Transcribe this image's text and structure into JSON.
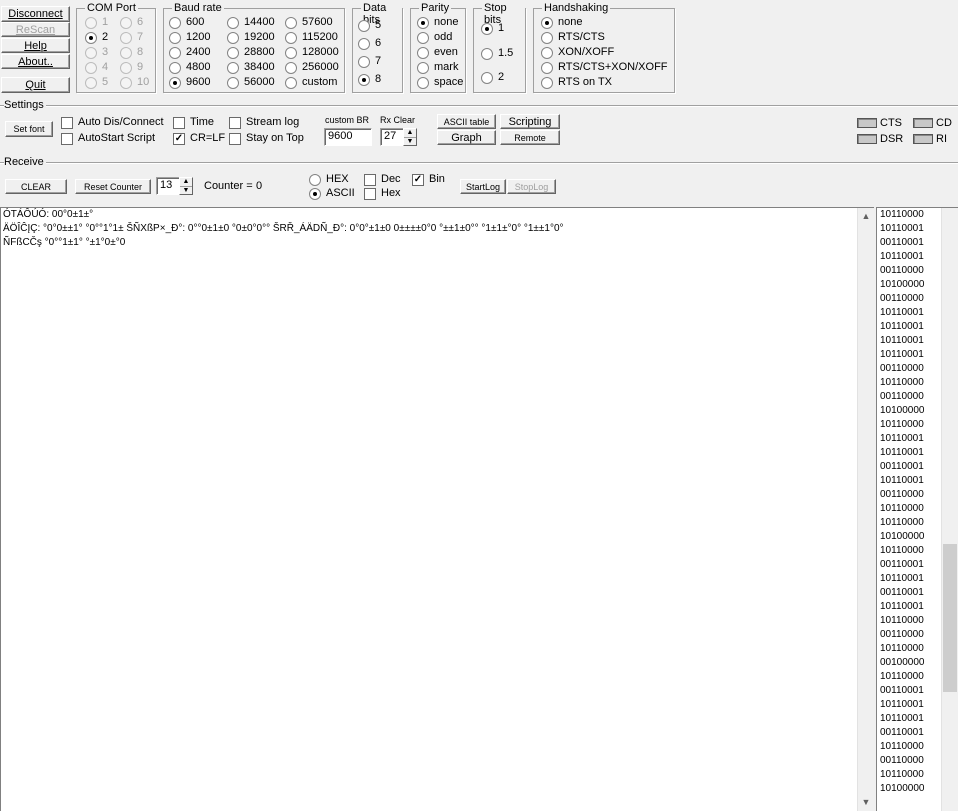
{
  "top": {
    "disconnect": "Disconnect",
    "rescan": "ReScan",
    "help": "Help",
    "about": "About..",
    "quit": "Quit"
  },
  "com_port": {
    "title": "COM Port",
    "ports": [
      "1",
      "2",
      "3",
      "4",
      "5",
      "6",
      "7",
      "8",
      "9",
      "10"
    ],
    "selected": "2"
  },
  "baud": {
    "title": "Baud rate",
    "rates": [
      "600",
      "1200",
      "2400",
      "4800",
      "9600",
      "14400",
      "19200",
      "28800",
      "38400",
      "56000",
      "57600",
      "115200",
      "128000",
      "256000",
      "custom"
    ],
    "selected": "9600"
  },
  "data_bits": {
    "title": "Data bits",
    "options": [
      "5",
      "6",
      "7",
      "8"
    ],
    "selected": "8"
  },
  "parity": {
    "title": "Parity",
    "options": [
      "none",
      "odd",
      "even",
      "mark",
      "space"
    ],
    "selected": "none"
  },
  "stop_bits": {
    "title": "Stop bits",
    "options": [
      "1",
      "1.5",
      "2"
    ],
    "selected": "1"
  },
  "handshaking": {
    "title": "Handshaking",
    "options": [
      "none",
      "RTS/CTS",
      "XON/XOFF",
      "RTS/CTS+XON/XOFF",
      "RTS on TX"
    ],
    "selected": "none"
  },
  "settings": {
    "label": "Settings",
    "set_font": "Set font",
    "auto_dis": "Auto Dis/Connect",
    "autostart": "AutoStart Script",
    "time": "Time",
    "crlf": "CR=LF",
    "stream_log": "Stream log",
    "stay_on_top": "Stay on Top",
    "custom_br_label": "custom BR",
    "custom_br_value": "9600",
    "rx_clear_label": "Rx Clear",
    "rx_clear_value": "27",
    "ascii_table": "ASCII table",
    "graph": "Graph",
    "scripting": "Scripting",
    "remote": "Remote",
    "cts": "CTS",
    "dsr": "DSR",
    "cd": "CD",
    "ri": "RI"
  },
  "receive": {
    "label": "Receive",
    "clear": "CLEAR",
    "reset_counter": "Reset Counter",
    "counter_spin": "13",
    "counter_label": "Counter =",
    "counter_value": "0",
    "hex": "HEX",
    "ascii": "ASCII",
    "dec": "Dec",
    "hex2": "Hex",
    "bin": "Bin",
    "startlog": "StartLog",
    "stoplog": "StopLog"
  },
  "terminal_lines": [
    "",
    "ÓTÁÔÚÓ: 00°0±1±°",
    "ÄÖÎĈĮÇ: °0°0±±1° °0°°1°1± ŠÑXßP×_Ð°: 0°°0±1±0 °0±0°0°° ŠRŘ_ÁÄDÑ_Ð°: 0°0°±1±0 0±±±±0°0 °±±1±0°° °1±1±°0° °1±±1°0°",
    "ÑFßCČş °0°°1±1° °±1°0±°0"
  ],
  "bin_values": [
    "10110000",
    "10110001",
    "00110001",
    "10110001",
    "00110000",
    "10100000",
    "00110000",
    "10110001",
    "10110001",
    "10110001",
    "10110001",
    "00110000",
    "10110000",
    "00110000",
    "10100000",
    "10110000",
    "10110001",
    "10110001",
    "00110001",
    "10110001",
    "00110000",
    "10110000",
    "10110000",
    "10100000",
    "10110000",
    "00110001",
    "10110001",
    "00110001",
    "10110001",
    "10110000",
    "00110000",
    "10110000",
    "00100000",
    "10110000",
    "00110001",
    "10110001",
    "10110001",
    "00110001",
    "10110000",
    "00110000",
    "10110000",
    "10100000"
  ]
}
